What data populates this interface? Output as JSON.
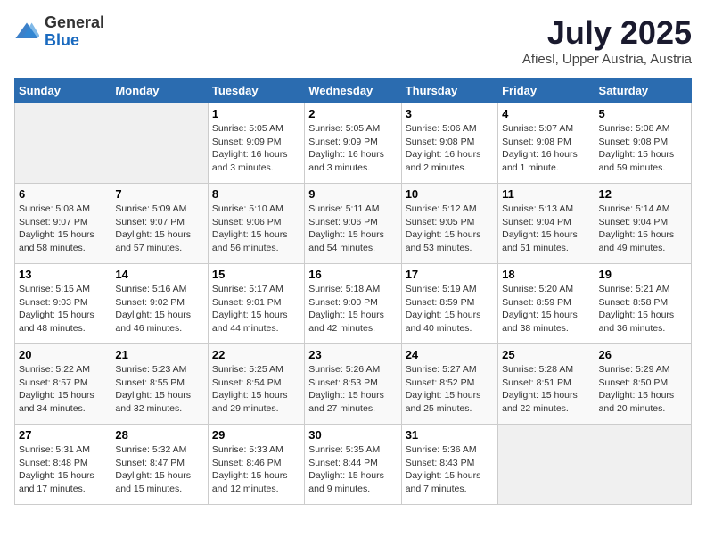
{
  "header": {
    "logo_general": "General",
    "logo_blue": "Blue",
    "title": "July 2025",
    "subtitle": "Afiesl, Upper Austria, Austria"
  },
  "calendar": {
    "days_of_week": [
      "Sunday",
      "Monday",
      "Tuesday",
      "Wednesday",
      "Thursday",
      "Friday",
      "Saturday"
    ],
    "weeks": [
      [
        {
          "day": "",
          "detail": ""
        },
        {
          "day": "",
          "detail": ""
        },
        {
          "day": "1",
          "detail": "Sunrise: 5:05 AM\nSunset: 9:09 PM\nDaylight: 16 hours\nand 3 minutes."
        },
        {
          "day": "2",
          "detail": "Sunrise: 5:05 AM\nSunset: 9:09 PM\nDaylight: 16 hours\nand 3 minutes."
        },
        {
          "day": "3",
          "detail": "Sunrise: 5:06 AM\nSunset: 9:08 PM\nDaylight: 16 hours\nand 2 minutes."
        },
        {
          "day": "4",
          "detail": "Sunrise: 5:07 AM\nSunset: 9:08 PM\nDaylight: 16 hours\nand 1 minute."
        },
        {
          "day": "5",
          "detail": "Sunrise: 5:08 AM\nSunset: 9:08 PM\nDaylight: 15 hours\nand 59 minutes."
        }
      ],
      [
        {
          "day": "6",
          "detail": "Sunrise: 5:08 AM\nSunset: 9:07 PM\nDaylight: 15 hours\nand 58 minutes."
        },
        {
          "day": "7",
          "detail": "Sunrise: 5:09 AM\nSunset: 9:07 PM\nDaylight: 15 hours\nand 57 minutes."
        },
        {
          "day": "8",
          "detail": "Sunrise: 5:10 AM\nSunset: 9:06 PM\nDaylight: 15 hours\nand 56 minutes."
        },
        {
          "day": "9",
          "detail": "Sunrise: 5:11 AM\nSunset: 9:06 PM\nDaylight: 15 hours\nand 54 minutes."
        },
        {
          "day": "10",
          "detail": "Sunrise: 5:12 AM\nSunset: 9:05 PM\nDaylight: 15 hours\nand 53 minutes."
        },
        {
          "day": "11",
          "detail": "Sunrise: 5:13 AM\nSunset: 9:04 PM\nDaylight: 15 hours\nand 51 minutes."
        },
        {
          "day": "12",
          "detail": "Sunrise: 5:14 AM\nSunset: 9:04 PM\nDaylight: 15 hours\nand 49 minutes."
        }
      ],
      [
        {
          "day": "13",
          "detail": "Sunrise: 5:15 AM\nSunset: 9:03 PM\nDaylight: 15 hours\nand 48 minutes."
        },
        {
          "day": "14",
          "detail": "Sunrise: 5:16 AM\nSunset: 9:02 PM\nDaylight: 15 hours\nand 46 minutes."
        },
        {
          "day": "15",
          "detail": "Sunrise: 5:17 AM\nSunset: 9:01 PM\nDaylight: 15 hours\nand 44 minutes."
        },
        {
          "day": "16",
          "detail": "Sunrise: 5:18 AM\nSunset: 9:00 PM\nDaylight: 15 hours\nand 42 minutes."
        },
        {
          "day": "17",
          "detail": "Sunrise: 5:19 AM\nSunset: 8:59 PM\nDaylight: 15 hours\nand 40 minutes."
        },
        {
          "day": "18",
          "detail": "Sunrise: 5:20 AM\nSunset: 8:59 PM\nDaylight: 15 hours\nand 38 minutes."
        },
        {
          "day": "19",
          "detail": "Sunrise: 5:21 AM\nSunset: 8:58 PM\nDaylight: 15 hours\nand 36 minutes."
        }
      ],
      [
        {
          "day": "20",
          "detail": "Sunrise: 5:22 AM\nSunset: 8:57 PM\nDaylight: 15 hours\nand 34 minutes."
        },
        {
          "day": "21",
          "detail": "Sunrise: 5:23 AM\nSunset: 8:55 PM\nDaylight: 15 hours\nand 32 minutes."
        },
        {
          "day": "22",
          "detail": "Sunrise: 5:25 AM\nSunset: 8:54 PM\nDaylight: 15 hours\nand 29 minutes."
        },
        {
          "day": "23",
          "detail": "Sunrise: 5:26 AM\nSunset: 8:53 PM\nDaylight: 15 hours\nand 27 minutes."
        },
        {
          "day": "24",
          "detail": "Sunrise: 5:27 AM\nSunset: 8:52 PM\nDaylight: 15 hours\nand 25 minutes."
        },
        {
          "day": "25",
          "detail": "Sunrise: 5:28 AM\nSunset: 8:51 PM\nDaylight: 15 hours\nand 22 minutes."
        },
        {
          "day": "26",
          "detail": "Sunrise: 5:29 AM\nSunset: 8:50 PM\nDaylight: 15 hours\nand 20 minutes."
        }
      ],
      [
        {
          "day": "27",
          "detail": "Sunrise: 5:31 AM\nSunset: 8:48 PM\nDaylight: 15 hours\nand 17 minutes."
        },
        {
          "day": "28",
          "detail": "Sunrise: 5:32 AM\nSunset: 8:47 PM\nDaylight: 15 hours\nand 15 minutes."
        },
        {
          "day": "29",
          "detail": "Sunrise: 5:33 AM\nSunset: 8:46 PM\nDaylight: 15 hours\nand 12 minutes."
        },
        {
          "day": "30",
          "detail": "Sunrise: 5:35 AM\nSunset: 8:44 PM\nDaylight: 15 hours\nand 9 minutes."
        },
        {
          "day": "31",
          "detail": "Sunrise: 5:36 AM\nSunset: 8:43 PM\nDaylight: 15 hours\nand 7 minutes."
        },
        {
          "day": "",
          "detail": ""
        },
        {
          "day": "",
          "detail": ""
        }
      ]
    ]
  }
}
